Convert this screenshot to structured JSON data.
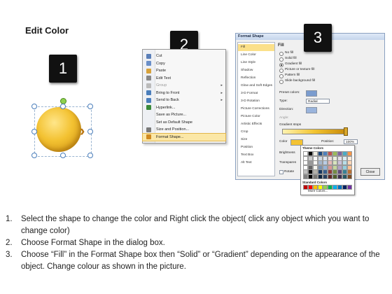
{
  "title": "Edit Color",
  "badges": [
    "1",
    "2",
    "3"
  ],
  "context_menu": {
    "items": [
      {
        "label": "Cut",
        "submenu": false,
        "disabled": false,
        "icon": "scissors-icon"
      },
      {
        "label": "Copy",
        "submenu": false,
        "disabled": false,
        "icon": "copy-icon"
      },
      {
        "label": "Paste",
        "submenu": false,
        "disabled": false,
        "icon": "paste-icon"
      },
      {
        "label": "Edit Text",
        "submenu": false,
        "disabled": false,
        "icon": "edit-text-icon"
      },
      {
        "label": "Group",
        "submenu": true,
        "disabled": true,
        "icon": "group-icon"
      },
      {
        "label": "Bring to Front",
        "submenu": true,
        "disabled": false,
        "icon": "bring-front-icon"
      },
      {
        "label": "Send to Back",
        "submenu": true,
        "disabled": false,
        "icon": "send-back-icon"
      },
      {
        "label": "Hyperlink...",
        "submenu": false,
        "disabled": false,
        "icon": "hyperlink-icon"
      },
      {
        "label": "Save as Picture...",
        "submenu": false,
        "disabled": false,
        "icon": ""
      },
      {
        "label": "Set as Default Shape",
        "submenu": false,
        "disabled": false,
        "icon": ""
      },
      {
        "label": "Size and Position...",
        "submenu": false,
        "disabled": false,
        "icon": "size-icon"
      },
      {
        "label": "Format Shape...",
        "submenu": false,
        "disabled": false,
        "icon": "format-shape-icon",
        "highlighted": true
      }
    ]
  },
  "dialog": {
    "title": "Format Shape",
    "nav": [
      "Fill",
      "Line Color",
      "Line Style",
      "Shadow",
      "Reflection",
      "Glow and Soft Edges",
      "3-D Format",
      "3-D Rotation",
      "Picture Corrections",
      "Picture Color",
      "Artistic Effects",
      "Crop",
      "Size",
      "Position",
      "Text Box",
      "Alt Text"
    ],
    "section": "Fill",
    "options": [
      "No fill",
      "Solid fill",
      "Gradient fill",
      "Picture or texture fill",
      "Pattern fill",
      "Slide background fill"
    ],
    "preset_label": "Preset colors:",
    "type_label": "Type:",
    "type_value": "Radial",
    "direction_label": "Direction:",
    "angle_label": "Angle:",
    "stops_label": "Gradient stops",
    "color_label": "Color",
    "position_label": "Position:",
    "position_value": "100%",
    "brightness_label": "Brightness",
    "transparency_label": "Transparen",
    "rotate_label": "Rotate",
    "close_label": "Close",
    "theme_colors_label": "Theme Colors",
    "standard_colors_label": "Standard Colors",
    "more_colors_label": "More Colors..."
  },
  "colors": {
    "theme_row": [
      "#ffffff",
      "#000000",
      "#eeece1",
      "#1f497d",
      "#4f81bd",
      "#c0504d",
      "#9bbb59",
      "#8064a2",
      "#4bacc6",
      "#f79646"
    ],
    "standard_row": [
      "#c00000",
      "#ff0000",
      "#ffc000",
      "#ffff00",
      "#92d050",
      "#00b050",
      "#00b0f0",
      "#0070c0",
      "#002060",
      "#7030a0"
    ]
  },
  "instructions": [
    {
      "num": "1.",
      "text": "Select the shape to change the color and Right click the object( click any object which you want to change color)"
    },
    {
      "num": "2.",
      "text": "Choose Format Shape in the dialog box."
    },
    {
      "num": "3.",
      "text": "Choose “Fill” in the Format Shape box then “Solid” or “Gradient” depending on the appearance of the object. Change colour as shown in the picture."
    }
  ]
}
